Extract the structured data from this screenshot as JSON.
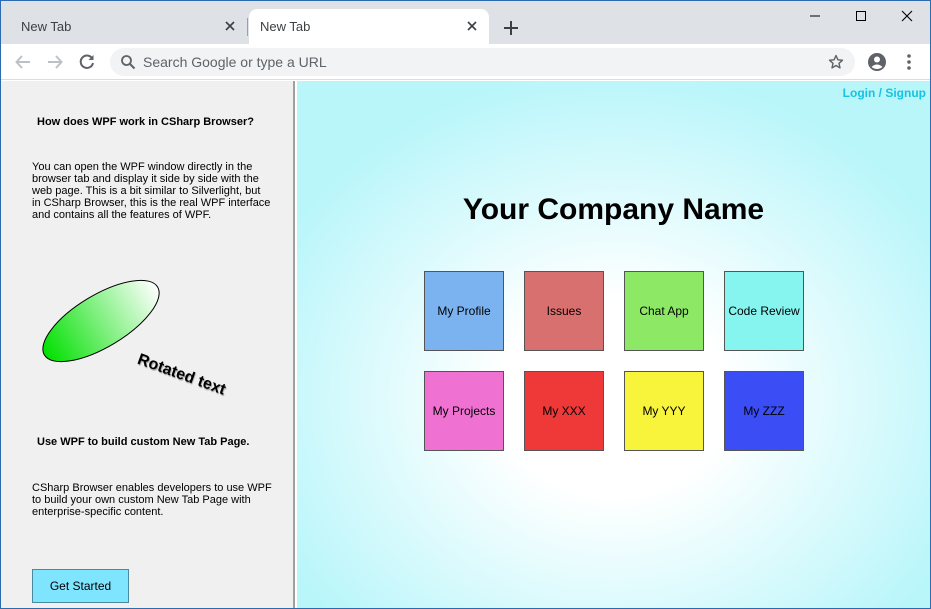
{
  "tabs": [
    {
      "label": "New Tab"
    },
    {
      "label": "New Tab"
    }
  ],
  "omnibox": {
    "placeholder": "Search Google or type a URL"
  },
  "left_panel": {
    "heading1": "How does WPF work in CSharp Browser?",
    "para1": "You can open the WPF window directly in the browser tab and display it side by side with the web page. This is a bit similar to Silverlight, but in CSharp Browser, this is the real WPF interface and contains all the features of WPF.",
    "rotated_text": "Rotated text",
    "heading2": "Use WPF to build custom New Tab Page.",
    "para2": "CSharp Browser enables developers to use WPF to build your own custom New Tab Page with enterprise-specific content.",
    "button_label": "Get Started"
  },
  "right_panel": {
    "login_label": "Login / Signup",
    "company_name": "Your Company Name",
    "tiles": [
      {
        "label": "My Profile",
        "color": "#7ab3f0"
      },
      {
        "label": "Issues",
        "color": "#d97070"
      },
      {
        "label": "Chat App",
        "color": "#8de865"
      },
      {
        "label": "Code Review",
        "color": "#86f5f0"
      },
      {
        "label": "My Projects",
        "color": "#ef72d3"
      },
      {
        "label": "My XXX",
        "color": "#ef3838"
      },
      {
        "label": "My YYY",
        "color": "#f8f43c"
      },
      {
        "label": "My ZZZ",
        "color": "#3b4ef6"
      }
    ]
  },
  "colors": {
    "tabstrip": "#dee1e6",
    "left_panel_bg": "#f0f0f0",
    "login_link": "#17c3e0",
    "button_bg": "#7fe5ff"
  }
}
